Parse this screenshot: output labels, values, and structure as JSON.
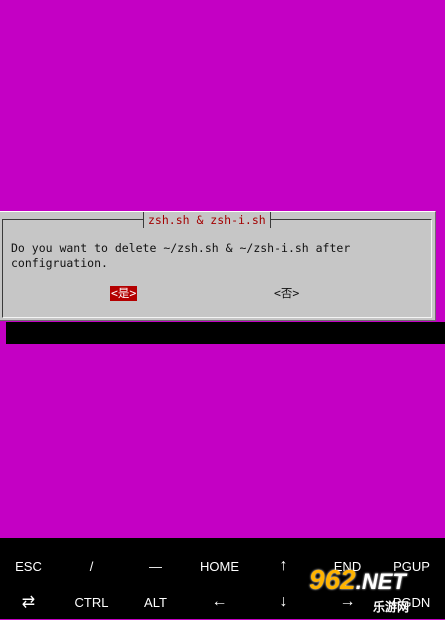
{
  "dialog": {
    "title": "zsh.sh & zsh-i.sh",
    "message": "Do you want to delete ~/zsh.sh & ~/zsh-i.sh after\nconfigruation.",
    "yes_label": "<是>",
    "no_label": "<否>"
  },
  "keys": {
    "row1": [
      "ESC",
      "/",
      "—",
      "HOME",
      "↑",
      "END",
      "PGUP"
    ],
    "row2": [
      "⇄",
      "CTRL",
      "ALT",
      "←",
      "↓",
      "→",
      "PGDN"
    ]
  },
  "watermark": {
    "logo": "962",
    "logo_suffix": ".NET",
    "subtitle": "乐游网"
  },
  "colors": {
    "terminal_bg": "#c400c4",
    "dialog_bg": "#c6c6c6",
    "title_color": "#a30000",
    "selected_button_bg": "#b40000",
    "keybar_bg": "#000000"
  }
}
